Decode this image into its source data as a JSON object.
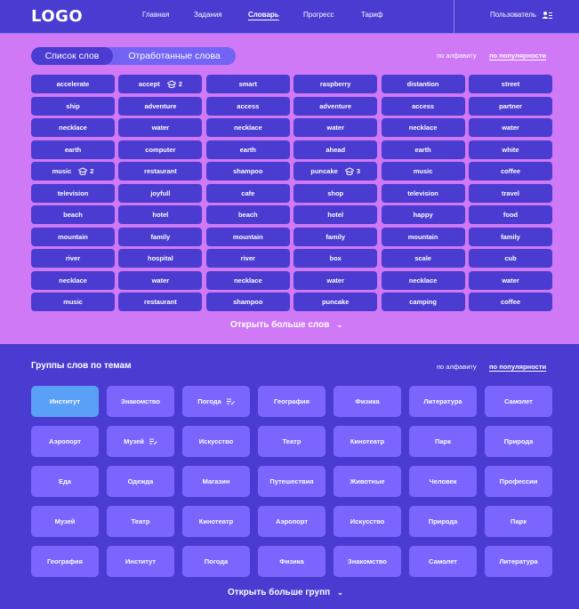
{
  "header": {
    "logo": "LOGO",
    "nav": [
      {
        "label": "Главная",
        "active": false
      },
      {
        "label": "Задания",
        "active": false
      },
      {
        "label": "Словарь",
        "active": true
      },
      {
        "label": "Прогресс",
        "active": false
      },
      {
        "label": "Тариф",
        "active": false
      }
    ],
    "user_label": "Пользователь",
    "user_icon": "user-list-icon"
  },
  "words": {
    "tabs": [
      {
        "label": "Список слов",
        "active": true
      },
      {
        "label": "Отработанные слова",
        "active": false
      }
    ],
    "sort_alpha": "по алфавиту",
    "sort_popular": "по популярности",
    "rows": [
      [
        {
          "w": "accelerate"
        },
        {
          "w": "accept",
          "count": "2"
        },
        {
          "w": "smart"
        },
        {
          "w": "raspberry"
        },
        {
          "w": "distantion"
        },
        {
          "w": "street"
        }
      ],
      [
        {
          "w": "ship"
        },
        {
          "w": "adventure"
        },
        {
          "w": "access"
        },
        {
          "w": "adventure"
        },
        {
          "w": "access"
        },
        {
          "w": "partner"
        }
      ],
      [
        {
          "w": "necklace"
        },
        {
          "w": "water"
        },
        {
          "w": "necklace"
        },
        {
          "w": "water"
        },
        {
          "w": "necklace"
        },
        {
          "w": "water"
        }
      ],
      [
        {
          "w": "earth"
        },
        {
          "w": "computer"
        },
        {
          "w": "earth"
        },
        {
          "w": "ahead"
        },
        {
          "w": "earth"
        },
        {
          "w": "white"
        }
      ],
      [
        {
          "w": "music",
          "count": "2"
        },
        {
          "w": "restaurant"
        },
        {
          "w": "shampoo"
        },
        {
          "w": "puncake",
          "count": "3"
        },
        {
          "w": "music"
        },
        {
          "w": "coffee"
        }
      ],
      [
        {
          "w": "television"
        },
        {
          "w": "joyfull"
        },
        {
          "w": "cafe"
        },
        {
          "w": "shop"
        },
        {
          "w": "television"
        },
        {
          "w": "travel"
        }
      ],
      [
        {
          "w": "beach"
        },
        {
          "w": "hotel"
        },
        {
          "w": "beach"
        },
        {
          "w": "hotel"
        },
        {
          "w": "happy"
        },
        {
          "w": "food"
        }
      ],
      [
        {
          "w": "mountain"
        },
        {
          "w": "family"
        },
        {
          "w": "mountain"
        },
        {
          "w": "family"
        },
        {
          "w": "mountain"
        },
        {
          "w": "family"
        }
      ],
      [
        {
          "w": "river"
        },
        {
          "w": "hospital"
        },
        {
          "w": "river"
        },
        {
          "w": "box"
        },
        {
          "w": "scale"
        },
        {
          "w": "cub"
        }
      ],
      [
        {
          "w": "necklace"
        },
        {
          "w": "water"
        },
        {
          "w": "necklace"
        },
        {
          "w": "water"
        },
        {
          "w": "necklace"
        },
        {
          "w": "water"
        }
      ],
      [
        {
          "w": "music"
        },
        {
          "w": "restaurant"
        },
        {
          "w": "shampoo"
        },
        {
          "w": "puncake"
        },
        {
          "w": "camping"
        },
        {
          "w": "coffee"
        }
      ]
    ],
    "more_label": "Открыть больше слов"
  },
  "groups": {
    "title": "Группы слов по темам",
    "sort_alpha": "по алфавиту",
    "sort_popular": "по популярности",
    "rows": [
      [
        {
          "name": "Институт",
          "selected": true
        },
        {
          "name": "Знакомство"
        },
        {
          "name": "Погода",
          "edit": true
        },
        {
          "name": "География"
        },
        {
          "name": "Физика"
        },
        {
          "name": "Литература"
        },
        {
          "name": "Самолет"
        }
      ],
      [
        {
          "name": "Аэропорт"
        },
        {
          "name": "Музей",
          "edit": true
        },
        {
          "name": "Искусство"
        },
        {
          "name": "Театр"
        },
        {
          "name": "Кинотеатр"
        },
        {
          "name": "Парк"
        },
        {
          "name": "Природа"
        }
      ],
      [
        {
          "name": "Еда"
        },
        {
          "name": "Одежда"
        },
        {
          "name": "Магазин"
        },
        {
          "name": "Путешествия"
        },
        {
          "name": "Животные"
        },
        {
          "name": "Человек"
        },
        {
          "name": "Профессии"
        }
      ],
      [
        {
          "name": "Музей"
        },
        {
          "name": "Театр"
        },
        {
          "name": "Кинотеатр"
        },
        {
          "name": "Аэропорт"
        },
        {
          "name": "Искусство"
        },
        {
          "name": "Природа"
        },
        {
          "name": "Парк"
        }
      ],
      [
        {
          "name": "География"
        },
        {
          "name": "Институт"
        },
        {
          "name": "Погода"
        },
        {
          "name": "Физика"
        },
        {
          "name": "Знакомство"
        },
        {
          "name": "Самолет"
        },
        {
          "name": "Литература"
        }
      ]
    ],
    "more_label": "Открыть больше групп"
  },
  "colors": {
    "primary": "#4a3bd1",
    "words_bg": "#cf79f7",
    "chip_light": "#7a66ff",
    "selected": "#5aa0f6"
  }
}
